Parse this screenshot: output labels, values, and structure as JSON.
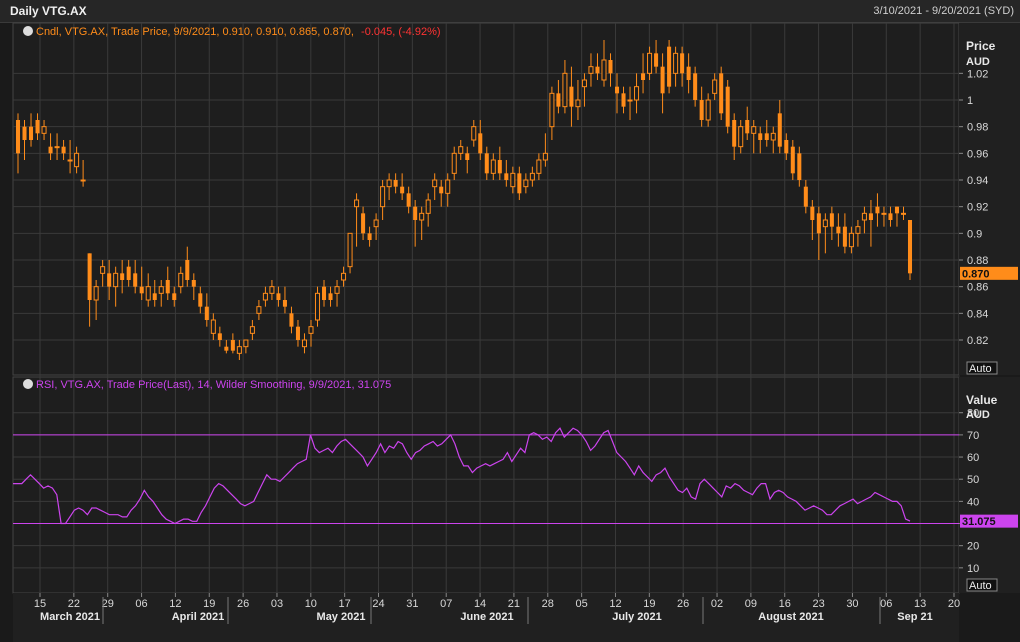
{
  "header": {
    "title": "Daily VTG.AX",
    "date_range": "3/10/2021 - 9/20/2021 (SYD)"
  },
  "price_panel": {
    "legend_prefix": "Cndl, VTG.AX, Trade Price, 9/9/2021, 0.910, 0.910, 0.865, 0.870,",
    "legend_change": "-0.045, (-4.92%)",
    "axis_title": "Price",
    "axis_unit": "AUD",
    "last_value": "0.870",
    "scale_button": "Auto"
  },
  "rsi_panel": {
    "legend": "RSI, VTG.AX, Trade Price(Last), 14, Wilder Smoothing, 9/9/2021, 31.075",
    "axis_title": "Value",
    "axis_unit": "AUD",
    "last_value": "31.075",
    "scale_button": "Auto"
  },
  "colors": {
    "up_candle": "#ff8c1a",
    "down_candle": "#ff8c1a",
    "rsi_line": "#cc44ee",
    "change_negative": "#ff3333",
    "grid": "#3a3a3a"
  },
  "chart_data": [
    {
      "type": "candlestick",
      "symbol": "VTG.AX",
      "ylabel": "Price AUD",
      "ylim": [
        0.805,
        1.045
      ],
      "yticks": [
        0.82,
        0.84,
        0.86,
        0.88,
        0.9,
        0.92,
        0.94,
        0.96,
        0.98,
        1,
        1.02
      ],
      "x_day_ticks": [
        "15",
        "22",
        "29",
        "06",
        "12",
        "19",
        "26",
        "03",
        "10",
        "17",
        "24",
        "31",
        "07",
        "14",
        "21",
        "28",
        "05",
        "12",
        "19",
        "26",
        "02",
        "09",
        "16",
        "23",
        "30",
        "06",
        "13",
        "20"
      ],
      "x_month_labels": [
        "March 2021",
        "April 2021",
        "May 2021",
        "June 2021",
        "July 2021",
        "August 2021",
        "Sep 21"
      ],
      "grid": true,
      "ohlc_order": "open, high, low, close",
      "candles": [
        [
          0.985,
          0.99,
          0.945,
          0.96
        ],
        [
          0.98,
          0.985,
          0.955,
          0.97
        ],
        [
          0.98,
          0.99,
          0.965,
          0.97
        ],
        [
          0.985,
          0.99,
          0.97,
          0.975
        ],
        [
          0.975,
          0.985,
          0.97,
          0.98
        ],
        [
          0.965,
          0.975,
          0.955,
          0.96
        ],
        [
          0.965,
          0.975,
          0.955,
          0.965
        ],
        [
          0.965,
          0.97,
          0.955,
          0.96
        ],
        [
          0.955,
          0.97,
          0.945,
          0.955
        ],
        [
          0.95,
          0.965,
          0.945,
          0.96
        ],
        [
          0.94,
          0.955,
          0.935,
          0.94
        ],
        [
          0.885,
          0.885,
          0.83,
          0.85
        ],
        [
          0.85,
          0.865,
          0.835,
          0.86
        ],
        [
          0.87,
          0.88,
          0.86,
          0.875
        ],
        [
          0.87,
          0.88,
          0.85,
          0.86
        ],
        [
          0.86,
          0.875,
          0.845,
          0.87
        ],
        [
          0.87,
          0.88,
          0.855,
          0.865
        ],
        [
          0.875,
          0.88,
          0.86,
          0.865
        ],
        [
          0.87,
          0.88,
          0.855,
          0.86
        ],
        [
          0.86,
          0.875,
          0.85,
          0.855
        ],
        [
          0.85,
          0.87,
          0.845,
          0.86
        ],
        [
          0.855,
          0.865,
          0.845,
          0.85
        ],
        [
          0.855,
          0.865,
          0.845,
          0.86
        ],
        [
          0.865,
          0.875,
          0.85,
          0.855
        ],
        [
          0.855,
          0.86,
          0.845,
          0.85
        ],
        [
          0.86,
          0.875,
          0.855,
          0.87
        ],
        [
          0.88,
          0.89,
          0.86,
          0.865
        ],
        [
          0.865,
          0.87,
          0.85,
          0.86
        ],
        [
          0.855,
          0.86,
          0.84,
          0.845
        ],
        [
          0.845,
          0.855,
          0.83,
          0.835
        ],
        [
          0.825,
          0.84,
          0.82,
          0.835
        ],
        [
          0.825,
          0.83,
          0.815,
          0.82
        ],
        [
          0.815,
          0.82,
          0.81,
          0.812
        ],
        [
          0.82,
          0.825,
          0.81,
          0.812
        ],
        [
          0.81,
          0.82,
          0.805,
          0.815
        ],
        [
          0.815,
          0.82,
          0.81,
          0.82
        ],
        [
          0.825,
          0.835,
          0.82,
          0.83
        ],
        [
          0.84,
          0.85,
          0.835,
          0.845
        ],
        [
          0.85,
          0.86,
          0.845,
          0.855
        ],
        [
          0.855,
          0.865,
          0.85,
          0.86
        ],
        [
          0.855,
          0.86,
          0.845,
          0.85
        ],
        [
          0.85,
          0.86,
          0.84,
          0.845
        ],
        [
          0.84,
          0.845,
          0.825,
          0.83
        ],
        [
          0.83,
          0.835,
          0.815,
          0.82
        ],
        [
          0.815,
          0.825,
          0.81,
          0.82
        ],
        [
          0.825,
          0.835,
          0.815,
          0.83
        ],
        [
          0.835,
          0.86,
          0.83,
          0.855
        ],
        [
          0.86,
          0.865,
          0.845,
          0.85
        ],
        [
          0.855,
          0.86,
          0.845,
          0.85
        ],
        [
          0.855,
          0.865,
          0.845,
          0.86
        ],
        [
          0.865,
          0.875,
          0.86,
          0.87
        ],
        [
          0.875,
          0.9,
          0.87,
          0.9
        ],
        [
          0.92,
          0.93,
          0.89,
          0.925
        ],
        [
          0.915,
          0.92,
          0.895,
          0.9
        ],
        [
          0.9,
          0.905,
          0.89,
          0.895
        ],
        [
          0.905,
          0.915,
          0.895,
          0.91
        ],
        [
          0.92,
          0.94,
          0.91,
          0.935
        ],
        [
          0.935,
          0.945,
          0.925,
          0.94
        ],
        [
          0.94,
          0.945,
          0.93,
          0.935
        ],
        [
          0.935,
          0.945,
          0.925,
          0.93
        ],
        [
          0.93,
          0.935,
          0.915,
          0.92
        ],
        [
          0.92,
          0.925,
          0.89,
          0.91
        ],
        [
          0.91,
          0.92,
          0.895,
          0.915
        ],
        [
          0.915,
          0.93,
          0.905,
          0.925
        ],
        [
          0.935,
          0.945,
          0.925,
          0.94
        ],
        [
          0.935,
          0.94,
          0.92,
          0.93
        ],
        [
          0.93,
          0.945,
          0.92,
          0.94
        ],
        [
          0.945,
          0.965,
          0.94,
          0.96
        ],
        [
          0.96,
          0.97,
          0.955,
          0.965
        ],
        [
          0.96,
          0.965,
          0.945,
          0.955
        ],
        [
          0.97,
          0.985,
          0.965,
          0.98
        ],
        [
          0.975,
          0.985,
          0.955,
          0.96
        ],
        [
          0.96,
          0.965,
          0.94,
          0.945
        ],
        [
          0.945,
          0.96,
          0.94,
          0.955
        ],
        [
          0.955,
          0.965,
          0.94,
          0.945
        ],
        [
          0.945,
          0.955,
          0.935,
          0.94
        ],
        [
          0.935,
          0.95,
          0.93,
          0.945
        ],
        [
          0.945,
          0.95,
          0.925,
          0.93
        ],
        [
          0.935,
          0.945,
          0.93,
          0.94
        ],
        [
          0.94,
          0.95,
          0.935,
          0.945
        ],
        [
          0.945,
          0.96,
          0.94,
          0.955
        ],
        [
          0.955,
          0.975,
          0.95,
          0.96
        ],
        [
          0.98,
          1.01,
          0.97,
          1.005
        ],
        [
          1.005,
          1.015,
          0.99,
          0.995
        ],
        [
          0.995,
          1.03,
          0.99,
          1.02
        ],
        [
          1.01,
          1.025,
          0.98,
          0.995
        ],
        [
          0.995,
          1.015,
          0.985,
          1.0
        ],
        [
          1.01,
          1.02,
          0.995,
          1.015
        ],
        [
          1.02,
          1.035,
          1.01,
          1.025
        ],
        [
          1.025,
          1.035,
          1.015,
          1.02
        ],
        [
          1.015,
          1.045,
          1.01,
          1.03
        ],
        [
          1.03,
          1.035,
          1.01,
          1.02
        ],
        [
          1.01,
          1.02,
          0.99,
          1.005
        ],
        [
          1.005,
          1.01,
          0.99,
          0.995
        ],
        [
          1.0,
          1.01,
          0.985,
          1.0
        ],
        [
          1.0,
          1.02,
          0.99,
          1.01
        ],
        [
          1.02,
          1.035,
          1.005,
          1.015
        ],
        [
          1.02,
          1.04,
          1.015,
          1.035
        ],
        [
          1.035,
          1.045,
          1.02,
          1.025
        ],
        [
          1.025,
          1.035,
          0.99,
          1.005
        ],
        [
          1.04,
          1.045,
          1.005,
          1.01
        ],
        [
          1.02,
          1.04,
          1.01,
          1.035
        ],
        [
          1.035,
          1.04,
          1.01,
          1.02
        ],
        [
          1.025,
          1.035,
          1.005,
          1.015
        ],
        [
          1.02,
          1.025,
          0.995,
          1.0
        ],
        [
          1.0,
          1.01,
          0.98,
          0.985
        ],
        [
          0.985,
          1.005,
          0.98,
          1.0
        ],
        [
          1.005,
          1.02,
          1.0,
          1.015
        ],
        [
          1.02,
          1.025,
          0.985,
          0.99
        ],
        [
          1.01,
          1.015,
          0.975,
          0.98
        ],
        [
          0.985,
          0.99,
          0.955,
          0.965
        ],
        [
          0.965,
          0.985,
          0.96,
          0.98
        ],
        [
          0.985,
          0.995,
          0.97,
          0.975
        ],
        [
          0.975,
          0.985,
          0.96,
          0.98
        ],
        [
          0.975,
          0.98,
          0.96,
          0.97
        ],
        [
          0.975,
          0.985,
          0.965,
          0.97
        ],
        [
          0.97,
          0.98,
          0.96,
          0.975
        ],
        [
          0.99,
          1.0,
          0.96,
          0.965
        ],
        [
          0.97,
          0.975,
          0.955,
          0.96
        ],
        [
          0.965,
          0.97,
          0.94,
          0.945
        ],
        [
          0.96,
          0.965,
          0.935,
          0.94
        ],
        [
          0.935,
          0.94,
          0.915,
          0.92
        ],
        [
          0.92,
          0.925,
          0.895,
          0.91
        ],
        [
          0.915,
          0.92,
          0.88,
          0.9
        ],
        [
          0.905,
          0.915,
          0.885,
          0.91
        ],
        [
          0.915,
          0.92,
          0.895,
          0.905
        ],
        [
          0.905,
          0.915,
          0.89,
          0.9
        ],
        [
          0.905,
          0.915,
          0.885,
          0.89
        ],
        [
          0.89,
          0.905,
          0.885,
          0.9
        ],
        [
          0.9,
          0.91,
          0.89,
          0.905
        ],
        [
          0.91,
          0.92,
          0.9,
          0.915
        ],
        [
          0.915,
          0.925,
          0.89,
          0.91
        ],
        [
          0.92,
          0.93,
          0.905,
          0.915
        ],
        [
          0.915,
          0.92,
          0.905,
          0.915
        ],
        [
          0.915,
          0.92,
          0.905,
          0.91
        ],
        [
          0.92,
          0.92,
          0.905,
          0.915
        ],
        [
          0.915,
          0.92,
          0.91,
          0.915
        ],
        [
          0.91,
          0.91,
          0.865,
          0.87
        ]
      ]
    },
    {
      "type": "line",
      "name": "RSI",
      "ylabel": "Value AUD",
      "ylim": [
        0,
        88
      ],
      "yticks": [
        10,
        20,
        30,
        40,
        50,
        60,
        70,
        80
      ],
      "reference_lines": [
        70,
        30
      ],
      "grid": true,
      "values": [
        48,
        48,
        48,
        50,
        52,
        50,
        48,
        46,
        47,
        46,
        43,
        30,
        30,
        33,
        36,
        37,
        36,
        34,
        37,
        37,
        36,
        35,
        34,
        34,
        34,
        33,
        33,
        36,
        38,
        41,
        45,
        42,
        40,
        37,
        34,
        32,
        31,
        30,
        31,
        32,
        32,
        31,
        31,
        35,
        38,
        42,
        46,
        48,
        47,
        45,
        43,
        41,
        39,
        38,
        39,
        40,
        44,
        48,
        52,
        50,
        50,
        49,
        51,
        53,
        55,
        57,
        58,
        59,
        70,
        64,
        62,
        63,
        64,
        62,
        65,
        67,
        68,
        66,
        64,
        62,
        60,
        56,
        59,
        62,
        66,
        62,
        65,
        64,
        67,
        66,
        62,
        59,
        62,
        63,
        65,
        66,
        67,
        65,
        66,
        68,
        70,
        66,
        60,
        56,
        56,
        53,
        55,
        56,
        57,
        56,
        57,
        58,
        59,
        62,
        58,
        61,
        64,
        62,
        70,
        71,
        70,
        68,
        69,
        67,
        71,
        73,
        69,
        71,
        73,
        72,
        70,
        67,
        63,
        65,
        68,
        71,
        72,
        67,
        62,
        60,
        58,
        55,
        52,
        56,
        53,
        51,
        49,
        52,
        53,
        55,
        51,
        48,
        45,
        44,
        46,
        42,
        41,
        48,
        50,
        48,
        46,
        44,
        42,
        47,
        46,
        48,
        47,
        45,
        44,
        43,
        46,
        48,
        48,
        41,
        44,
        45,
        44,
        42,
        41,
        40,
        38,
        36,
        37,
        38,
        37,
        36,
        34,
        34,
        36,
        38,
        39,
        40,
        41,
        39,
        40,
        41,
        42,
        44,
        43,
        42,
        41,
        40,
        40,
        38,
        32,
        31.075
      ]
    }
  ]
}
